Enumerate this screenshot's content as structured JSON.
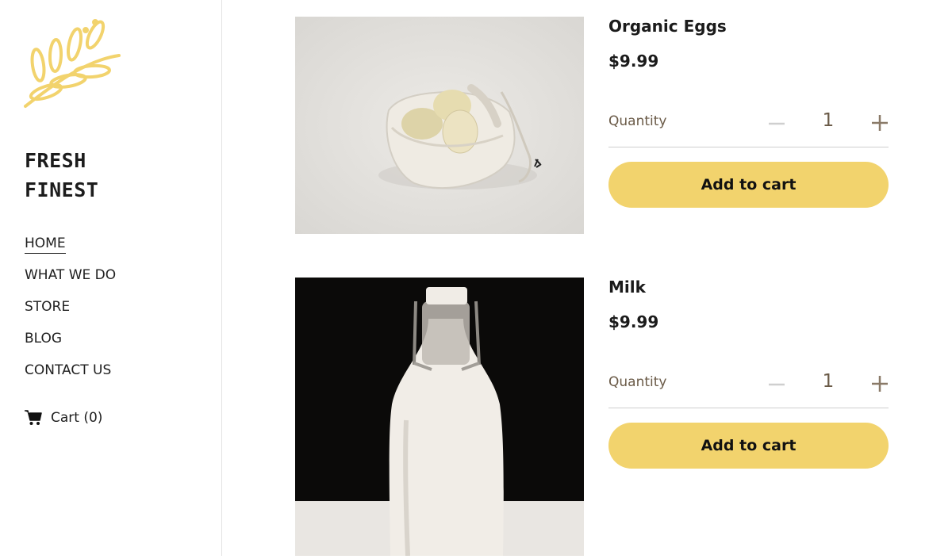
{
  "brand": {
    "line1": "FRESH",
    "line2": "FINEST",
    "logo_icon": "wheat-leaf-icon",
    "logo_color": "#f2d36d"
  },
  "nav": {
    "items": [
      {
        "label": "HOME",
        "active": true
      },
      {
        "label": "WHAT WE DO"
      },
      {
        "label": "STORE"
      },
      {
        "label": "BLOG"
      },
      {
        "label": "CONTACT US"
      }
    ]
  },
  "cart": {
    "label": "Cart (0)",
    "icon": "shopping-cart-icon"
  },
  "products": [
    {
      "name": "Organic Eggs",
      "price": "$9.99",
      "quantity_label": "Quantity",
      "quantity": "1",
      "button": "Add to cart",
      "image": "eggs-in-cloth-bag"
    },
    {
      "name": "Milk",
      "price": "$9.99",
      "quantity_label": "Quantity",
      "quantity": "1",
      "button": "Add to cart",
      "image": "milk-bottle"
    }
  ],
  "colors": {
    "accent": "#f2d36d",
    "text": "#1b1b1b",
    "muted": "#6a5a47"
  }
}
